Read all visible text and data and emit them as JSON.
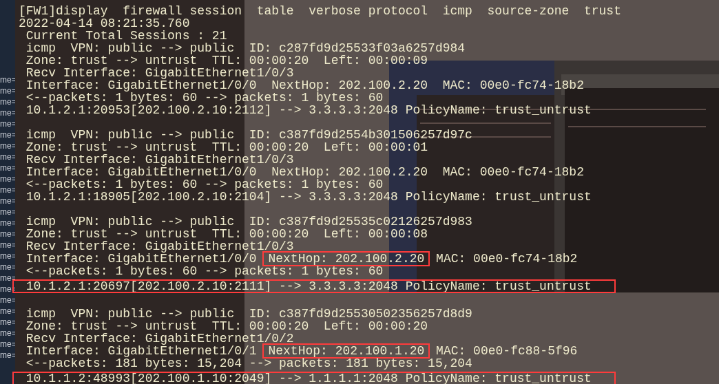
{
  "background": {
    "log_fragments": [
      "me=",
      "me=",
      "me=",
      "me=",
      "me=",
      "me=",
      "me=",
      "me=",
      "me=",
      "me=",
      "me=",
      "me=",
      "me=",
      "me=",
      "me=",
      "me=",
      "me=",
      "me=",
      "me=",
      "me=",
      "me=",
      "me=",
      "me=",
      "me=",
      "me=",
      "me="
    ]
  },
  "terminal": {
    "header": [
      "[FW1]display  firewall session  table  verbose protocol  icmp  source-zone  trust",
      "2022-04-14 08:21:35.760",
      " Current Total Sessions : 21"
    ],
    "sessions": [
      {
        "lines": [
          {
            "parts": [
              {
                "text": " icmp  VPN: public --> public  ID: c287fd9d25533f03a6257d984",
                "boxed": false
              }
            ],
            "boxed": false
          },
          {
            "parts": [
              {
                "text": " Zone: trust --> untrust  TTL: 00:00:20  Left: 00:00:09",
                "boxed": false
              }
            ],
            "boxed": false
          },
          {
            "parts": [
              {
                "text": " Recv Interface: GigabitEthernet1/0/3",
                "boxed": false
              }
            ],
            "boxed": false
          },
          {
            "parts": [
              {
                "text": " Interface: GigabitEthernet1/0/0  NextHop: 202.100.2.20  MAC: 00e0-fc74-18b2",
                "boxed": false
              }
            ],
            "boxed": false
          },
          {
            "parts": [
              {
                "text": " <--packets: 1 bytes: 60 --> packets: 1 bytes: 60",
                "boxed": false
              }
            ],
            "boxed": false
          },
          {
            "parts": [
              {
                "text": " 10.1.2.1:20953[202.100.2.10:2112] --> 3.3.3.3:2048 PolicyName: trust_untrust",
                "boxed": false
              }
            ],
            "boxed": false
          }
        ]
      },
      {
        "lines": [
          {
            "parts": [
              {
                "text": " icmp  VPN: public --> public  ID: c387fd9d2554b301506257d97c",
                "boxed": false
              }
            ],
            "boxed": false
          },
          {
            "parts": [
              {
                "text": " Zone: trust --> untrust  TTL: 00:00:20  Left: 00:00:01",
                "boxed": false
              }
            ],
            "boxed": false
          },
          {
            "parts": [
              {
                "text": " Recv Interface: GigabitEthernet1/0/3",
                "boxed": false
              }
            ],
            "boxed": false
          },
          {
            "parts": [
              {
                "text": " Interface: GigabitEthernet1/0/0  NextHop: 202.100.2.20  MAC: 00e0-fc74-18b2",
                "boxed": false
              }
            ],
            "boxed": false
          },
          {
            "parts": [
              {
                "text": " <--packets: 1 bytes: 60 --> packets: 1 bytes: 60",
                "boxed": false
              }
            ],
            "boxed": false
          },
          {
            "parts": [
              {
                "text": " 10.1.2.1:18905[202.100.2.10:2104] --> 3.3.3.3:2048 PolicyName: trust_untrust",
                "boxed": false
              }
            ],
            "boxed": false
          }
        ]
      },
      {
        "lines": [
          {
            "parts": [
              {
                "text": " icmp  VPN: public --> public  ID: c387fd9d25535c02126257d983",
                "boxed": false
              }
            ],
            "boxed": false
          },
          {
            "parts": [
              {
                "text": " Zone: trust --> untrust  TTL: 00:00:20  Left: 00:00:08",
                "boxed": false
              }
            ],
            "boxed": false
          },
          {
            "parts": [
              {
                "text": " Recv Interface: GigabitEthernet1/0/3",
                "boxed": false
              }
            ],
            "boxed": false
          },
          {
            "parts": [
              {
                "text": " Interface: GigabitEthernet1/0/0 ",
                "boxed": false
              },
              {
                "text": "NextHop: 202.100.2.20",
                "boxed": true
              },
              {
                "text": " MAC: 00e0-fc74-18b2",
                "boxed": false
              }
            ],
            "boxed": false
          },
          {
            "parts": [
              {
                "text": " <--packets: 1 bytes: 60 --> packets: 1 bytes: 60",
                "boxed": false
              }
            ],
            "boxed": false
          },
          {
            "parts": [
              {
                "text": " 10.1.2.1:20697[202.100.2.10:2111] --> 3.3.3.3:2048 PolicyName: trust_untrust",
                "boxed": false
              }
            ],
            "boxed": true
          }
        ]
      },
      {
        "lines": [
          {
            "parts": [
              {
                "text": " icmp  VPN: public --> public  ID: c387fd9d25530502356257d8d9",
                "boxed": false
              }
            ],
            "boxed": false
          },
          {
            "parts": [
              {
                "text": " Zone: trust --> untrust  TTL: 00:00:20  Left: 00:00:20",
                "boxed": false
              }
            ],
            "boxed": false
          },
          {
            "parts": [
              {
                "text": " Recv Interface: GigabitEthernet1/0/2",
                "boxed": false
              }
            ],
            "boxed": false
          },
          {
            "parts": [
              {
                "text": " Interface: GigabitEthernet1/0/1 ",
                "boxed": false
              },
              {
                "text": "NextHop: 202.100.1.20",
                "boxed": true
              },
              {
                "text": " MAC: 00e0-fc88-5f96",
                "boxed": false
              }
            ],
            "boxed": false
          },
          {
            "parts": [
              {
                "text": " <--packets: 181 bytes: 15,204 --> packets: 181 bytes: 15,204",
                "boxed": false
              }
            ],
            "boxed": false
          },
          {
            "parts": [
              {
                "text": " 10.1.1.2:48993[202.100.1.10:2049] --> 1.1.1.1:2048 PolicyName: trust_untrust",
                "boxed": false
              }
            ],
            "boxed": true
          }
        ]
      }
    ]
  }
}
